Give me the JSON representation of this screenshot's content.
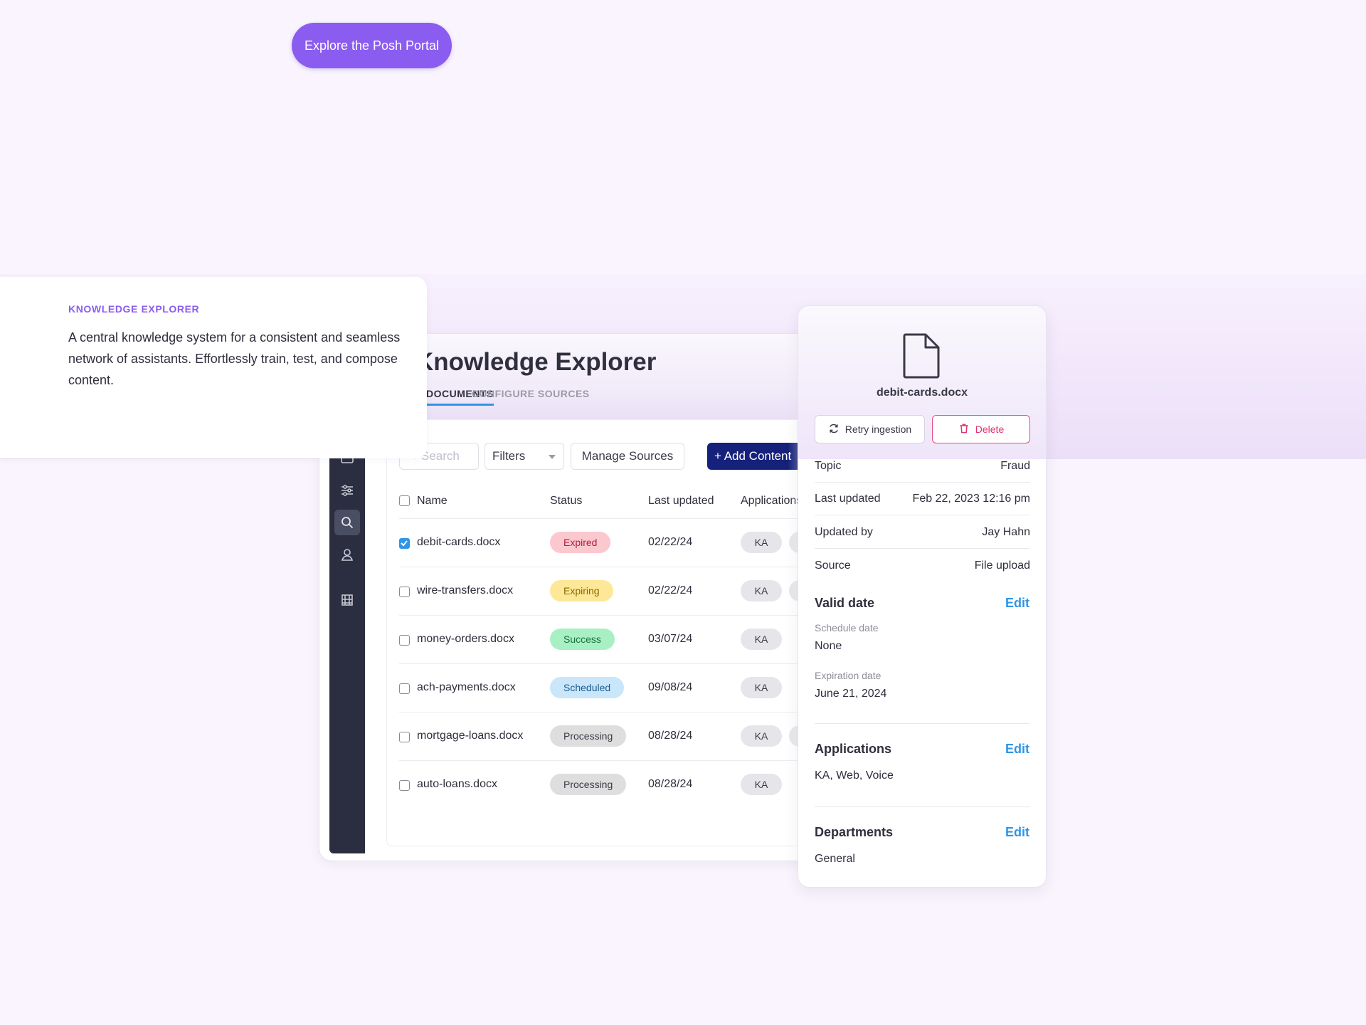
{
  "hero": {
    "cta_label": "Explore the Posh Portal"
  },
  "info": {
    "eyebrow": "KNOWLEDGE EXPLORER",
    "description": "A central knowledge system for a consistent and seamless network of assistants. Effortlessly train, test, and compose content."
  },
  "app": {
    "title": "Knowledge Explorer",
    "tabs": [
      "DOCUMENTS",
      "CONFIGURE SOURCES"
    ],
    "toolbar": {
      "search_placeholder": "Search",
      "filters_label": "Filters",
      "manage_label": "Manage Sources",
      "add_label": "+ Add Content"
    },
    "columns": [
      "Name",
      "Status",
      "Last updated",
      "Applications"
    ],
    "rows": [
      {
        "name": "debit-cards.docx",
        "status": "Expired",
        "updated": "02/22/24",
        "app": "KA",
        "checked": true
      },
      {
        "name": "wire-transfers.docx",
        "status": "Expiring",
        "updated": "02/22/24",
        "app": "KA",
        "checked": false
      },
      {
        "name": "money-orders.docx",
        "status": "Success",
        "updated": "03/07/24",
        "app": "KA",
        "checked": false
      },
      {
        "name": "ach-payments.docx",
        "status": "Scheduled",
        "updated": "09/08/24",
        "app": "KA",
        "checked": false
      },
      {
        "name": "mortgage-loans.docx",
        "status": "Processing",
        "updated": "08/28/24",
        "app": "KA",
        "checked": false
      },
      {
        "name": "auto-loans.docx",
        "status": "Processing",
        "updated": "08/28/24",
        "app": "KA",
        "checked": false
      }
    ],
    "rail_icons": [
      "chat-icon",
      "card-icon",
      "sliders-icon",
      "search-icon",
      "user-icon",
      "building-icon"
    ]
  },
  "status_colors": {
    "Expired": {
      "bg": "#fbc8cf",
      "fg": "#b01d3b"
    },
    "Expiring": {
      "bg": "#fde897",
      "fg": "#8a6a00"
    },
    "Success": {
      "bg": "#a8f0c3",
      "fg": "#17703f"
    },
    "Scheduled": {
      "bg": "#c9e6fb",
      "fg": "#1d5c8f"
    },
    "Processing": {
      "bg": "#dededf",
      "fg": "#3a3a47"
    }
  },
  "detail": {
    "filename": "debit-cards.docx",
    "retry_label": "Retry ingestion",
    "delete_label": "Delete",
    "fields": [
      {
        "key": "Topic",
        "value": "Fraud"
      },
      {
        "key": "Last updated",
        "value": "Feb 22, 2023 12:16 pm"
      },
      {
        "key": "Updated by",
        "value": "Jay Hahn"
      },
      {
        "key": "Source",
        "value": "File upload"
      }
    ],
    "valid_date": {
      "title": "Valid date",
      "edit": "Edit",
      "schedule_label": "Schedule date",
      "schedule_value": "None",
      "expiration_label": "Expiration date",
      "expiration_value": "June 21, 2024"
    },
    "applications": {
      "title": "Applications",
      "edit": "Edit",
      "value": "KA, Web, Voice"
    },
    "departments": {
      "title": "Departments",
      "edit": "Edit",
      "value": "General"
    }
  }
}
